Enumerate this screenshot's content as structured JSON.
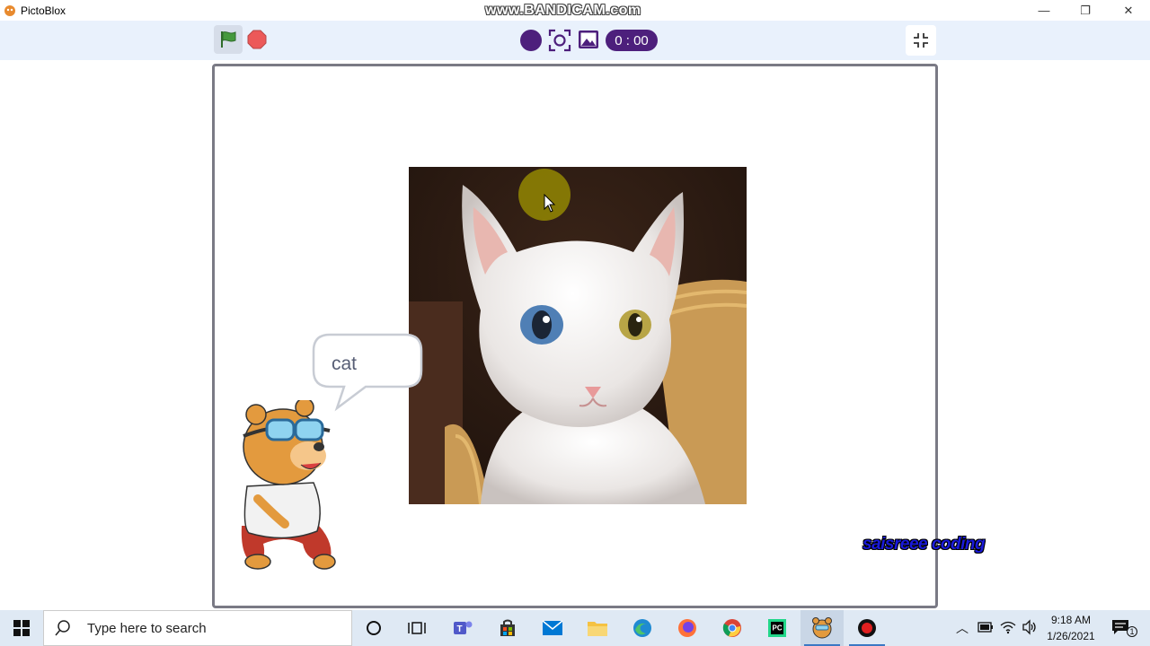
{
  "window": {
    "title": "PictoBlox",
    "recorder_watermark": "www.BANDICAM.com",
    "controls": {
      "minimize": "—",
      "restore": "❐",
      "close": "✕"
    }
  },
  "toolbar": {
    "green_flag_icon": "green-flag-icon",
    "stop_icon": "stop-sign-icon",
    "record_icon": "record-circle-icon",
    "screenshot_icon": "camera-capture-icon",
    "image_icon": "image-icon",
    "timer": "0 : 00",
    "fullscreen_icon": "exit-fullscreen-icon"
  },
  "stage": {
    "speech_text": "cat",
    "brand_watermark": "saisreee coding"
  },
  "taskbar": {
    "search_placeholder": "Type here to search",
    "clock_time": "9:18 AM",
    "clock_date": "1/26/2021",
    "notification_count": "1",
    "pinned": [
      "cortana",
      "task-view",
      "teams",
      "store",
      "mail",
      "file-explorer",
      "edge",
      "firefox",
      "chrome",
      "pycharm",
      "pictoblox",
      "bandicam"
    ]
  },
  "colors": {
    "toolbar_bg": "#e9f1fc",
    "accent_purple": "#4d1f7c",
    "stop_red": "#ec5959",
    "flag_green": "#45993d",
    "taskbar_bg": "#dfe9f4"
  }
}
